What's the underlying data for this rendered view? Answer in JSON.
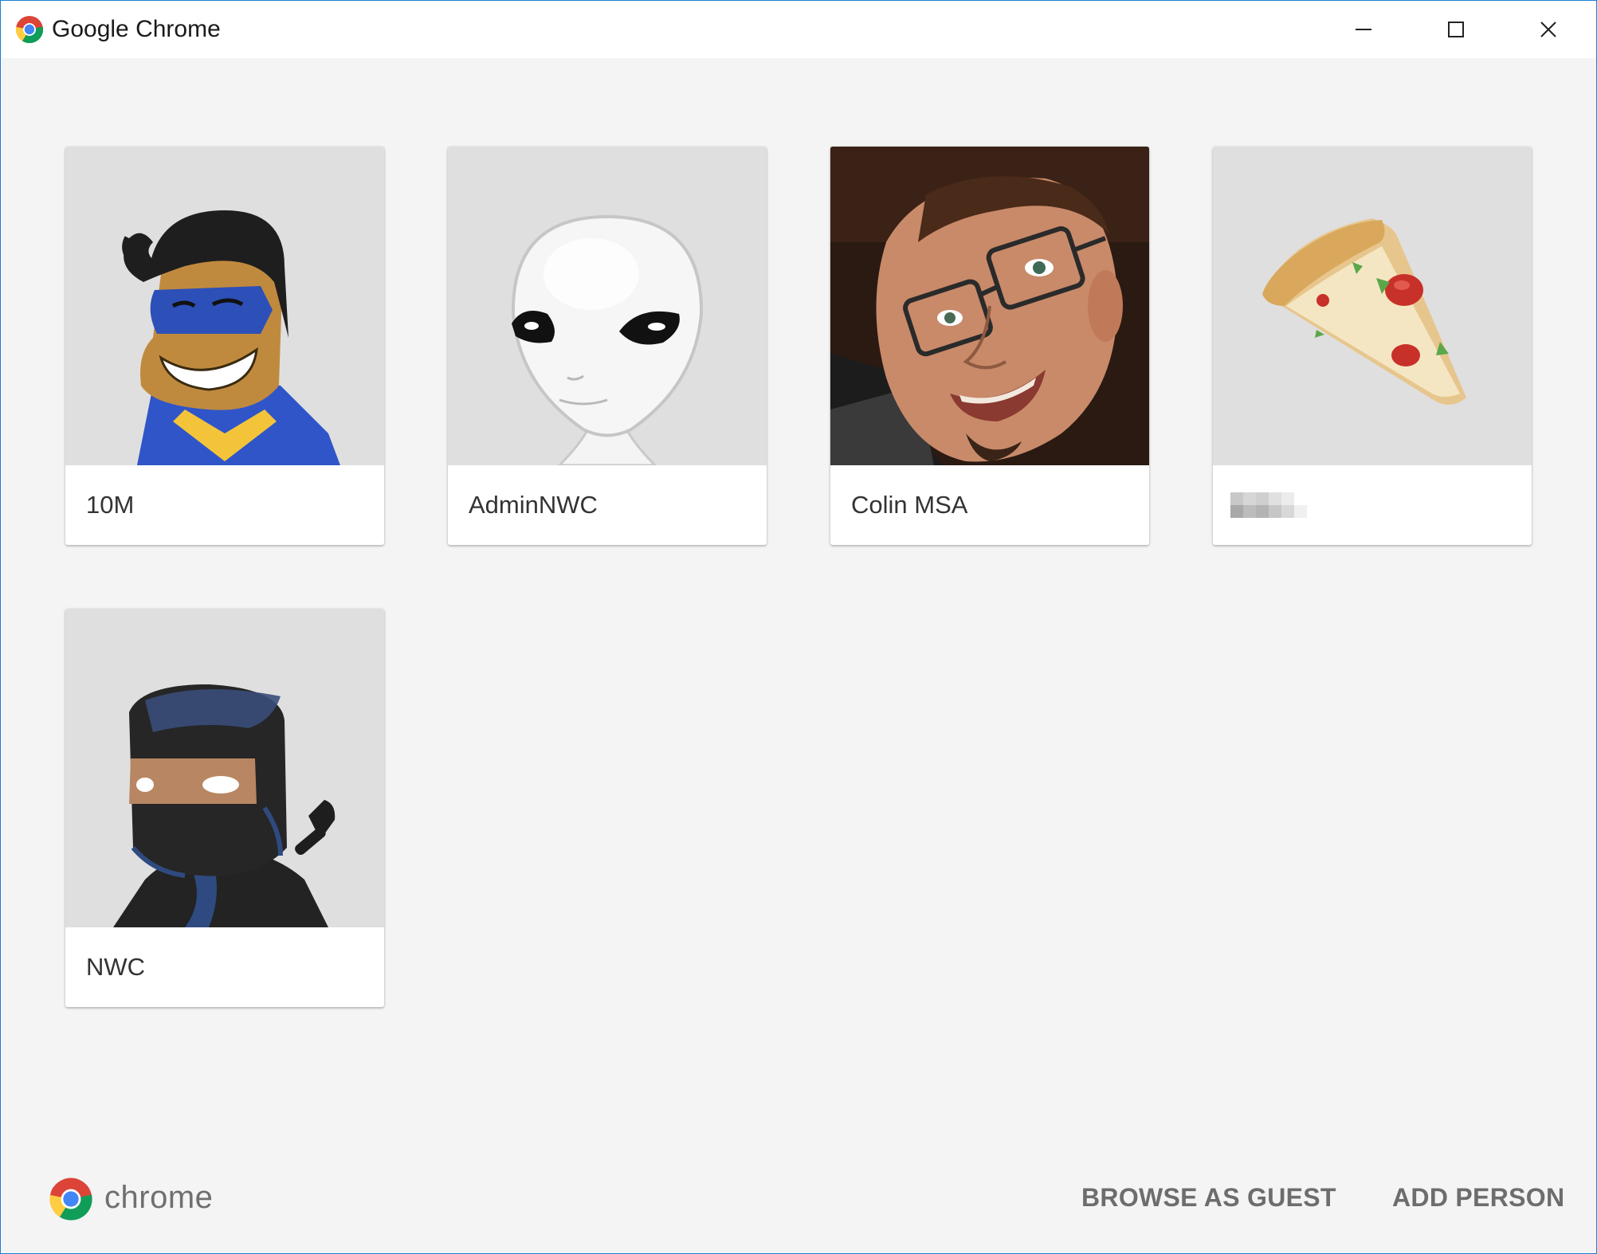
{
  "window": {
    "title": "Google Chrome",
    "accent_border": "#1a7fd4"
  },
  "profiles": [
    {
      "name": "10M",
      "avatar": "superhero-avatar"
    },
    {
      "name": "AdminNWC",
      "avatar": "alien-avatar"
    },
    {
      "name": "Colin MSA",
      "avatar": "photo-avatar"
    },
    {
      "name": "",
      "avatar": "pizza-avatar",
      "name_obscured": true
    },
    {
      "name": "NWC",
      "avatar": "ninja-avatar"
    }
  ],
  "footer": {
    "brand": "chrome",
    "browse_guest_label": "BROWSE AS GUEST",
    "add_person_label": "ADD PERSON"
  },
  "icons": {
    "title_logo": "chrome-logo-icon",
    "minimize": "minimize-icon",
    "maximize": "maximize-icon",
    "close": "close-icon"
  }
}
